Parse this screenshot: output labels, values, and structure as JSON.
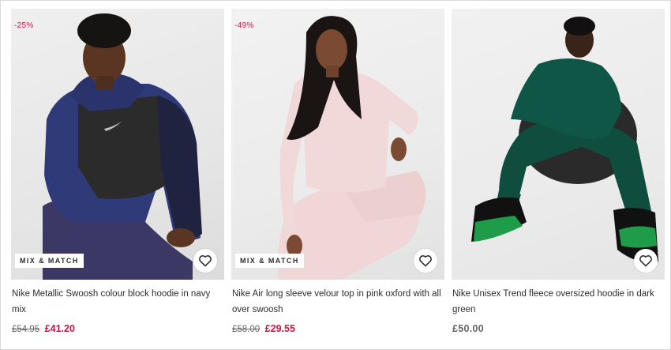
{
  "products": [
    {
      "discount": "-25%",
      "tag": "MIX & MATCH",
      "title": "Nike Metallic Swoosh colour block hoodie in navy mix",
      "old_price": "£54.95",
      "price": "£41.20"
    },
    {
      "discount": "-49%",
      "tag": "MIX & MATCH",
      "title": "Nike Air long sleeve velour top in pink oxford with all over swoosh",
      "old_price": "£58.00",
      "price": "£29.55"
    },
    {
      "title": "Nike Unisex Trend fleece oversized hoodie in dark green",
      "price": "£50.00"
    }
  ],
  "colors": {
    "sale": "#d01345",
    "text": "#2d2d2d",
    "muted": "#666666"
  },
  "icons": {
    "save": "heart-icon"
  }
}
